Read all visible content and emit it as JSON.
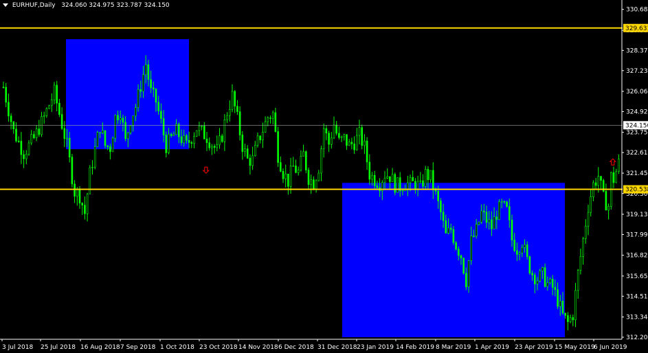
{
  "header": {
    "symbol": "EURHUF,Daily",
    "ohlc": "324.060 324.975 323.787 324.150"
  },
  "colors": {
    "background": "#000000",
    "candle": "#00ff00",
    "zone": "#0000ff",
    "level_line": "#ffd700",
    "bid_line": "#a0a0a0",
    "arrow": "#ff0000",
    "axis_text": "#ffffff"
  },
  "chart_data": {
    "type": "candlestick",
    "ylim": [
      312.2,
      330.9
    ],
    "y_ticks": [
      330.68,
      329.5,
      328.37,
      327.23,
      326.06,
      324.92,
      323.75,
      322.61,
      321.45,
      320.3,
      319.13,
      317.99,
      316.82,
      315.65,
      314.51,
      313.34,
      312.2
    ],
    "x_ticks": [
      "3 Jul 2018",
      "25 Jul 2018",
      "16 Aug 2018",
      "7 Sep 2018",
      "1 Oct 2018",
      "23 Oct 2018",
      "14 Nov 2018",
      "6 Dec 2018",
      "31 Dec 2018",
      "23 Jan 2019",
      "14 Feb 2019",
      "8 Mar 2019",
      "1 Apr 2019",
      "23 Apr 2019",
      "15 May 2019",
      "6 Jun 2019"
    ],
    "bars": 242,
    "close_path": [
      [
        0,
        326.3
      ],
      [
        4,
        323.8
      ],
      [
        8,
        322.6
      ],
      [
        12,
        323.4
      ],
      [
        16,
        324.6
      ],
      [
        20,
        326.0
      ],
      [
        25,
        323.0
      ],
      [
        28,
        320.4
      ],
      [
        30,
        320.2
      ],
      [
        32,
        319.2
      ],
      [
        34,
        321.4
      ],
      [
        36,
        322.8
      ],
      [
        38,
        324.1
      ],
      [
        40,
        323.0
      ],
      [
        42,
        322.9
      ],
      [
        44,
        324.6
      ],
      [
        46,
        325.0
      ],
      [
        48,
        323.2
      ],
      [
        50,
        324.5
      ],
      [
        52,
        325.2
      ],
      [
        56,
        327.6
      ],
      [
        58,
        326.0
      ],
      [
        60,
        325.5
      ],
      [
        62,
        324.3
      ],
      [
        64,
        323.0
      ],
      [
        68,
        323.8
      ],
      [
        72,
        323.0
      ],
      [
        76,
        324.0
      ],
      [
        80,
        323.5
      ],
      [
        84,
        322.7
      ],
      [
        86,
        323.6
      ],
      [
        88,
        324.9
      ],
      [
        90,
        325.8
      ],
      [
        92,
        324.5
      ],
      [
        94,
        323.0
      ],
      [
        96,
        322.2
      ],
      [
        98,
        322.2
      ],
      [
        100,
        323.2
      ],
      [
        104,
        324.6
      ],
      [
        106,
        324.8
      ],
      [
        108,
        322.5
      ],
      [
        110,
        321.5
      ],
      [
        112,
        321.0
      ],
      [
        114,
        321.8
      ],
      [
        116,
        321.5
      ],
      [
        118,
        322.5
      ],
      [
        120,
        321.2
      ],
      [
        122,
        320.9
      ],
      [
        124,
        321.8
      ],
      [
        126,
        324.0
      ],
      [
        128,
        323.1
      ],
      [
        130,
        324.2
      ],
      [
        132,
        323.2
      ],
      [
        134,
        323.4
      ],
      [
        136,
        323.0
      ],
      [
        138,
        323.2
      ],
      [
        140,
        323.6
      ],
      [
        142,
        322.9
      ],
      [
        144,
        321.4
      ],
      [
        146,
        321.1
      ],
      [
        148,
        320.9
      ],
      [
        150,
        321.4
      ],
      [
        152,
        321.3
      ],
      [
        154,
        320.8
      ],
      [
        156,
        320.7
      ],
      [
        158,
        320.9
      ],
      [
        160,
        320.8
      ],
      [
        162,
        320.9
      ],
      [
        164,
        320.6
      ],
      [
        166,
        321.4
      ],
      [
        168,
        321.2
      ],
      [
        170,
        320.2
      ],
      [
        172,
        319.2
      ],
      [
        174,
        317.9
      ],
      [
        176,
        318.3
      ],
      [
        178,
        317.4
      ],
      [
        180,
        316.8
      ],
      [
        182,
        315.4
      ],
      [
        184,
        317.6
      ],
      [
        186,
        318.2
      ],
      [
        188,
        319.2
      ],
      [
        190,
        318.8
      ],
      [
        192,
        318.4
      ],
      [
        194,
        319.2
      ],
      [
        196,
        319.6
      ],
      [
        198,
        319.3
      ],
      [
        200,
        317.7
      ],
      [
        202,
        317.2
      ],
      [
        204,
        317.6
      ],
      [
        206,
        316.5
      ],
      [
        208,
        315.8
      ],
      [
        210,
        315.5
      ],
      [
        212,
        315.7
      ],
      [
        214,
        315.2
      ],
      [
        216,
        315.0
      ],
      [
        218,
        314.3
      ],
      [
        220,
        313.4
      ],
      [
        222,
        313.0
      ],
      [
        224,
        313.5
      ],
      [
        226,
        315.8
      ],
      [
        228,
        317.7
      ],
      [
        230,
        319.6
      ],
      [
        232,
        320.8
      ],
      [
        234,
        321.3
      ],
      [
        236,
        320.0
      ],
      [
        238,
        319.6
      ]
    ],
    "close_path_2": [
      [
        238,
        321.4
      ],
      [
        240,
        321.1
      ],
      [
        242,
        322.0
      ],
      [
        244,
        321.6
      ],
      [
        246,
        321.9
      ],
      [
        248,
        321.2
      ],
      [
        250,
        320.2
      ],
      [
        252,
        319.3
      ],
      [
        254,
        319.6
      ],
      [
        256,
        320.0
      ],
      [
        258,
        320.6
      ],
      [
        260,
        322.0
      ],
      [
        262,
        323.5
      ],
      [
        264,
        323.3
      ],
      [
        266,
        323.9
      ],
      [
        268,
        323.1
      ],
      [
        270,
        324.0
      ],
      [
        272,
        324.4
      ],
      [
        274,
        324.8
      ],
      [
        276,
        325.9
      ],
      [
        278,
        326.6
      ],
      [
        280,
        326.2
      ],
      [
        282,
        326.4
      ],
      [
        284,
        325.7
      ],
      [
        286,
        325.5
      ],
      [
        288,
        324.6
      ],
      [
        290,
        322.7
      ],
      [
        292,
        320.8
      ],
      [
        294,
        320.4
      ],
      [
        296,
        320.8
      ],
      [
        298,
        321.6
      ],
      [
        300,
        322.4
      ],
      [
        302,
        323.3
      ],
      [
        304,
        324.1
      ]
    ],
    "zones": [
      {
        "x0": 96,
        "x1": 275,
        "y0": 329.0,
        "y1": 322.8
      },
      {
        "x0": 498,
        "x1": 822,
        "y0": 320.9,
        "y1": 312.2
      }
    ],
    "levels": [
      {
        "value": 329.631,
        "label": "329.631"
      },
      {
        "value": 320.538,
        "label": "320.538"
      }
    ],
    "bid": {
      "value": 324.15,
      "label": "324.150"
    },
    "arrows": [
      {
        "dir": "down",
        "bar": 84,
        "value": 321.6
      },
      {
        "dir": "up",
        "bar": 244,
        "value": 322.1
      }
    ]
  }
}
